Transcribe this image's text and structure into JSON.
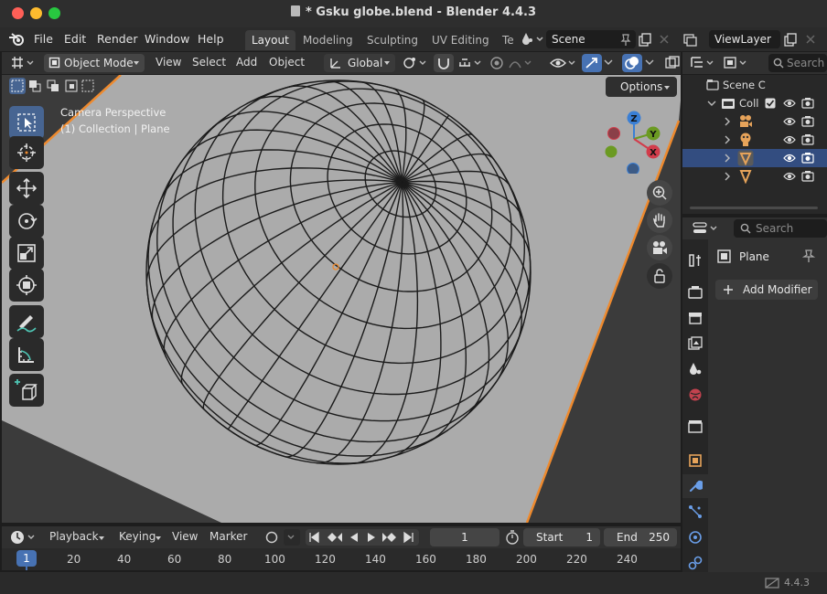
{
  "window": {
    "title": "* Gsku globe.blend - Blender 4.4.3",
    "traffic_lights": {
      "close": "#ff5f57",
      "minimize": "#febc2e",
      "zoom": "#28c840"
    }
  },
  "menubar": {
    "items": [
      "File",
      "Edit",
      "Render",
      "Window",
      "Help"
    ],
    "workspaces": [
      "Layout",
      "Modeling",
      "Sculpting",
      "UV Editing",
      "Te"
    ],
    "active_workspace": "Layout",
    "scene": "Scene",
    "view_layer": "ViewLayer"
  },
  "viewport_header": {
    "mode": "Object Mode",
    "menus": [
      "View",
      "Select",
      "Add",
      "Object"
    ],
    "transform_orientation": "Global"
  },
  "viewport": {
    "view_name": "Camera Perspective",
    "collection_info": "(1) Collection | Plane",
    "options_label": "Options",
    "gizmo_axes": {
      "x": "X",
      "y": "Y",
      "z": "Z"
    },
    "axis_colors": {
      "x": "#d23c4b",
      "y": "#6b9a22",
      "z": "#3a7fd5"
    },
    "selection_outline_color": "#ee8a2e",
    "tools": [
      "select-box-icon",
      "cursor-icon",
      "move-icon",
      "rotate-icon",
      "scale-icon",
      "transform-icon",
      "annotate-icon",
      "measure-icon",
      "add-cube-icon"
    ],
    "active_tool": "select-box-icon"
  },
  "outliner": {
    "search_placeholder": "Search",
    "scene_collection": "Scene C",
    "collection": "Coll",
    "objects": [
      "camera",
      "light",
      "plane",
      "sphere"
    ],
    "selected_object": "plane"
  },
  "properties": {
    "search_placeholder": "Search",
    "object_name": "Plane",
    "add_modifier_label": "Add Modifier",
    "active_tab": "modifiers"
  },
  "timeline": {
    "menus": [
      "Playback",
      "Keying",
      "View",
      "Marker"
    ],
    "current_frame": "1",
    "start_label": "Start",
    "start": "1",
    "end_label": "End",
    "end": "250",
    "playhead_label": "1",
    "ruler": [
      "20",
      "40",
      "60",
      "80",
      "100",
      "120",
      "140",
      "160",
      "180",
      "200",
      "220",
      "240"
    ]
  },
  "statusbar": {
    "version": "4.4.3"
  }
}
